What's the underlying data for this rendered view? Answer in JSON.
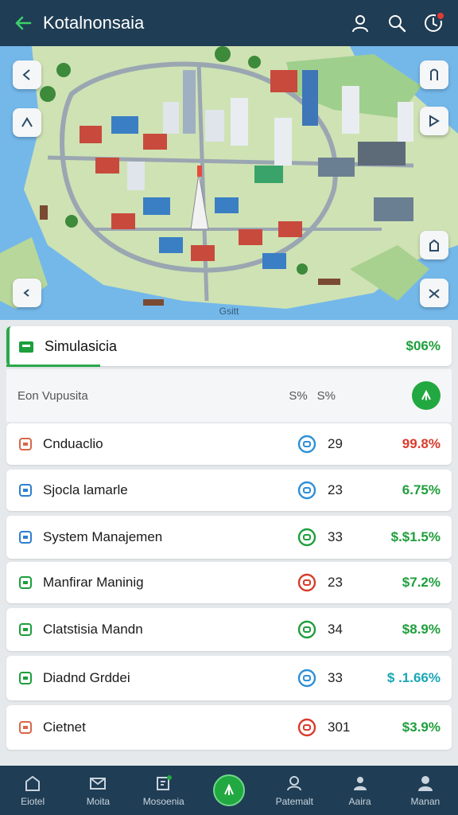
{
  "header": {
    "title": "Kotalnonsaia",
    "notification_badge": true
  },
  "map": {
    "label": "Gsitt"
  },
  "summary": {
    "title": "Simulasicia",
    "value": "$06%"
  },
  "columns": {
    "name": "Eon Vupusita",
    "col1": "S%",
    "col2": "S%"
  },
  "rows": [
    {
      "label": "Cnduaclio",
      "count": "29",
      "pct": "99.8%",
      "color": "#d93b2b",
      "icon": "cylinder-icon",
      "status_color": "#2d8fd8"
    },
    {
      "label": "Sjocla lamarle",
      "count": "23",
      "pct": "6.75%",
      "color": "#1e9e3c",
      "icon": "phone-icon",
      "status_color": "#2d8fd8"
    },
    {
      "label": "System Manajemen",
      "count": "33",
      "pct": "$.$1.5%",
      "color": "#1e9e3c",
      "icon": "monitor-icon",
      "status_color": "#1e9e3c"
    },
    {
      "label": "Manfirar Maninig",
      "count": "23",
      "pct": "$7.2%",
      "color": "#1e9e3c",
      "icon": "battery-icon",
      "status_color": "#d93b2b"
    },
    {
      "label": "Clatstisia Mandn",
      "count": "34",
      "pct": "$8.9%",
      "color": "#1e9e3c",
      "icon": "document-icon",
      "status_color": "#1e9e3c"
    },
    {
      "label": "Diadnd Grddei",
      "count": "33",
      "pct": "$ .1.66%",
      "color": "#18a7b5",
      "icon": "clipboard-icon",
      "status_color": "#2d8fd8"
    },
    {
      "label": "Cietnet",
      "count": "301",
      "pct": "$3.9%",
      "color": "#1e9e3c",
      "icon": "minus-circle-icon",
      "status_color": "#d93b2b"
    }
  ],
  "nav": [
    {
      "label": "Eiotel",
      "icon": "home-icon"
    },
    {
      "label": "Moita",
      "icon": "mail-icon"
    },
    {
      "label": "Mosoenia",
      "icon": "edit-icon"
    },
    {
      "label": "Patemalt",
      "icon": "person-icon"
    },
    {
      "label": "Aaira",
      "icon": "profile-icon"
    },
    {
      "label": "Manan",
      "icon": "user-icon"
    }
  ]
}
